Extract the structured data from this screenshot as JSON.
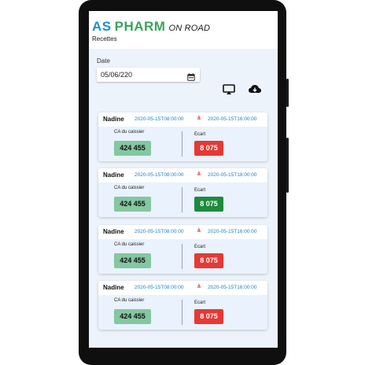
{
  "app": {
    "brand_as": "AS",
    "brand_pharm": "PHARM",
    "brand_suffix": "ON ROAD",
    "subtitle": "Recettes"
  },
  "filter": {
    "date_label": "Date",
    "date_value": "05/06/220",
    "calendar_icon": "calendar-icon"
  },
  "toolbar": {
    "cast_icon": "cast-icon",
    "download_icon": "cloud-download-icon"
  },
  "labels": {
    "ca": "CA du caissier",
    "ecart": "Ecart",
    "separator": "à"
  },
  "colors": {
    "brand_blue": "#1f8fc4",
    "brand_green": "#3aa35d",
    "ca_green": "#84c7a0",
    "ecart_red": "#e53935",
    "ecart_green": "#1e8a3c",
    "timestamp_blue": "#1f7fc4"
  },
  "cards": [
    {
      "name": "Nadine",
      "start": "2020-05-15T08:00:00",
      "end": "2020-05-15T16:00:00",
      "ca": "424 455",
      "ecart": "8 075",
      "ecart_status": "negative"
    },
    {
      "name": "Nadine",
      "start": "2020-05-15T08:00:00",
      "end": "2020-05-15T18:00:00",
      "ca": "424 455",
      "ecart": "8 075",
      "ecart_status": "positive"
    },
    {
      "name": "Nadine",
      "start": "2020-05-15T08:00:00",
      "end": "2020-05-15T16:00:00",
      "ca": "424 455",
      "ecart": "8 075",
      "ecart_status": "negative"
    },
    {
      "name": "Nadine",
      "start": "2020-05-15T08:00:00",
      "end": "2020-05-15T16:00:00",
      "ca": "424 455",
      "ecart": "8 075",
      "ecart_status": "negative"
    }
  ]
}
